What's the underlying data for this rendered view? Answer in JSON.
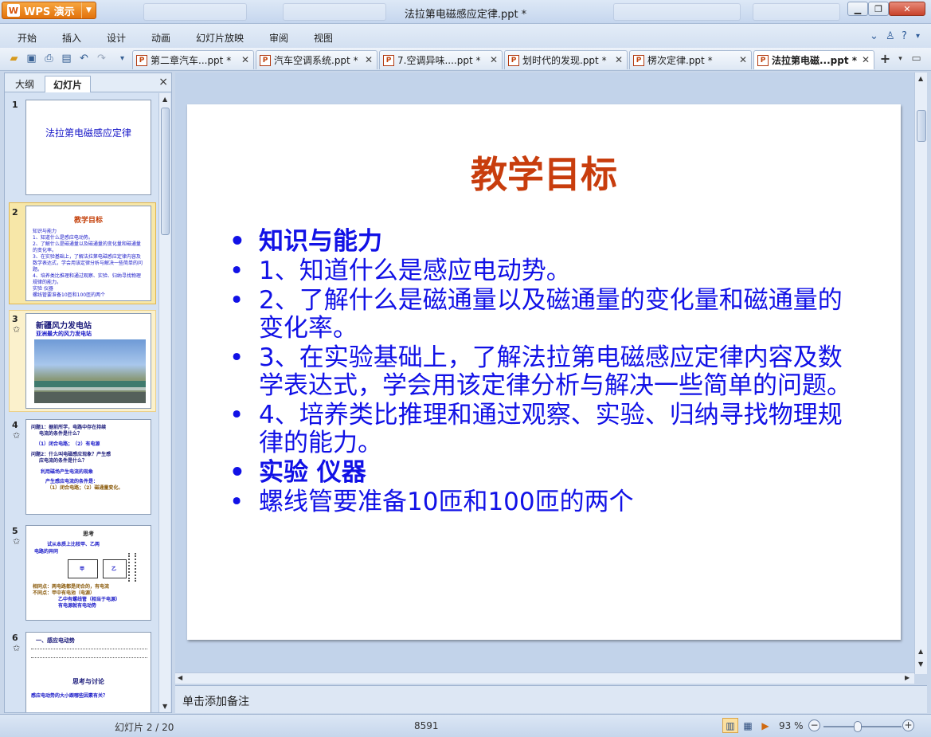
{
  "app": {
    "name": "WPS 演示",
    "window_title": "法拉第电磁感应定律.ppt *",
    "logo_glyph": "W"
  },
  "menu": [
    "开始",
    "插入",
    "设计",
    "动画",
    "幻灯片放映",
    "审阅",
    "视图"
  ],
  "doc_tabs": [
    {
      "label": "第二章汽车...ppt *"
    },
    {
      "label": "汽车空调系统.ppt *"
    },
    {
      "label": "7.空调异味....ppt *"
    },
    {
      "label": "划时代的发现.ppt *"
    },
    {
      "label": "楞次定律.ppt *"
    },
    {
      "label": "法拉第电磁...ppt *"
    }
  ],
  "left_panel": {
    "tab_outline": "大纲",
    "tab_slides": "幻灯片",
    "close": "×"
  },
  "thumbnails": {
    "s1": {
      "num": "1",
      "title": "法拉第电磁感应定律"
    },
    "s2": {
      "num": "2",
      "title": "教学目标"
    },
    "s3": {
      "num": "3",
      "title": "新疆风力发电站",
      "subtitle": "亚洲最大的风力发电站"
    },
    "s4": {
      "num": "4",
      "lines": [
        "问题1：据前所学，电路中存在持续",
        "电流的条件是什么？",
        "（1）闭合电路；　（2）有电源",
        "问题2：什么叫电磁感应现象？产生感",
        "应电流的条件是什么？",
        "利用磁场产生电流的现象",
        "产生感应电流的条件是：",
        "（1）闭合电路；（2）磁通量变化。"
      ]
    },
    "s5": {
      "num": "5",
      "lines": [
        "思考",
        "试从本质上比较甲、乙两",
        "电路的异同",
        "相同点：两电路都是闭合的，有电流",
        "不同点：甲中有电池（电源）",
        "乙中有螺线管（相当于电源）",
        "有电源就有电动势"
      ],
      "label_a": "甲",
      "label_b": "乙"
    },
    "s6": {
      "num": "6",
      "lines": [
        "一、感应电动势",
        "思考与讨论",
        "感应电动势的大小跟哪些因素有关？"
      ]
    }
  },
  "slide": {
    "title": "教学目标",
    "bullets": [
      {
        "text": "知识与能力",
        "bold": true
      },
      {
        "text": "1、知道什么是感应电动势。",
        "bold": false
      },
      {
        "text": "2、了解什么是磁通量以及磁通量的变化量和磁通量的变化率。",
        "bold": false
      },
      {
        "text": "3、在实验基础上，了解法拉第电磁感应定律内容及数学表达式，学会用该定律分析与解决一些简单的问题。",
        "bold": false
      },
      {
        "text": "4、培养类比推理和通过观察、实验、归纳寻找物理规律的能力。",
        "bold": false
      },
      {
        "text": "实验 仪器",
        "bold": true
      },
      {
        "text": "螺线管要准备10匝和100匝的两个",
        "bold": false
      }
    ]
  },
  "notes_placeholder": "单击添加备注",
  "status": {
    "slide_position": "幻灯片 2 / 20",
    "center_number": "8591",
    "zoom": "93 %"
  },
  "colors": {
    "title_red": "#c83d0d",
    "bullet_blue": "#1111e6",
    "wps_orange": "#e2720b"
  }
}
